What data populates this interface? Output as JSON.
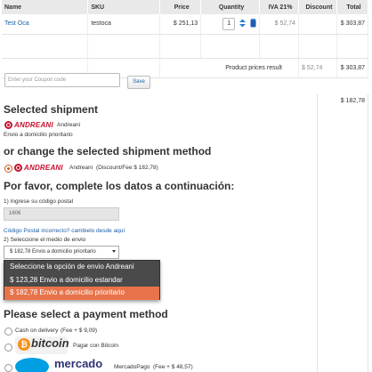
{
  "cart": {
    "headers": [
      "Name",
      "SKU",
      "Price",
      "Quantity",
      "IVA 21%",
      "Discount",
      "Total"
    ],
    "row": {
      "name": "Test Oca",
      "sku": "testoca",
      "price": "$ 251,13",
      "qty": "1",
      "iva": "$ 52,74",
      "discount": "",
      "total": "$ 303,87"
    },
    "product_prices_label": "Product prices result",
    "product_prices_iva": "$ 52,74",
    "product_prices_total": "$ 303,87"
  },
  "coupon": {
    "placeholder": "Enter your Coupon code",
    "button": "Save"
  },
  "right_total": "$ 182,78",
  "shipment": {
    "selected_title": "Selected shipment",
    "selected_carrier": "Andreani",
    "selected_desc": "Envio a domicilio prioritario",
    "logo_word": "ANDREANI",
    "change_title": "or change the selected shipment method",
    "option_name": "Andreani",
    "option_detail": "(Discount/Fee $ 182,78)",
    "complete_title": "Por favor, complete los datos a continuación:",
    "postal_label": "1) Ingrese su código postal",
    "postal_value": "1606",
    "postal_link": "Código Postal incorrecto? cambielo desde aquí",
    "method_label": "2) Seleccione el medio de envio",
    "select_value": "$ 182,78 Envio a domicilio prioritario",
    "dropdown_options": [
      "Seleccione la opción de envio Andreani",
      "$ 123,28 Envio a domicilio estandar",
      "$ 182,78 Envio a domicilio prioritario"
    ]
  },
  "payment": {
    "title": "Please select a payment method",
    "cod_label": "Cash on delivery",
    "cod_fee": "(Fee + $ 9,09)",
    "bitcoin_logo_word": "bitcoin",
    "bitcoin_label": "Pagar con Bitcoin",
    "mp_logo_word": "mercado",
    "mp_label": "MercadoPago",
    "mp_fee": "(Fee + $ 48,57)"
  }
}
